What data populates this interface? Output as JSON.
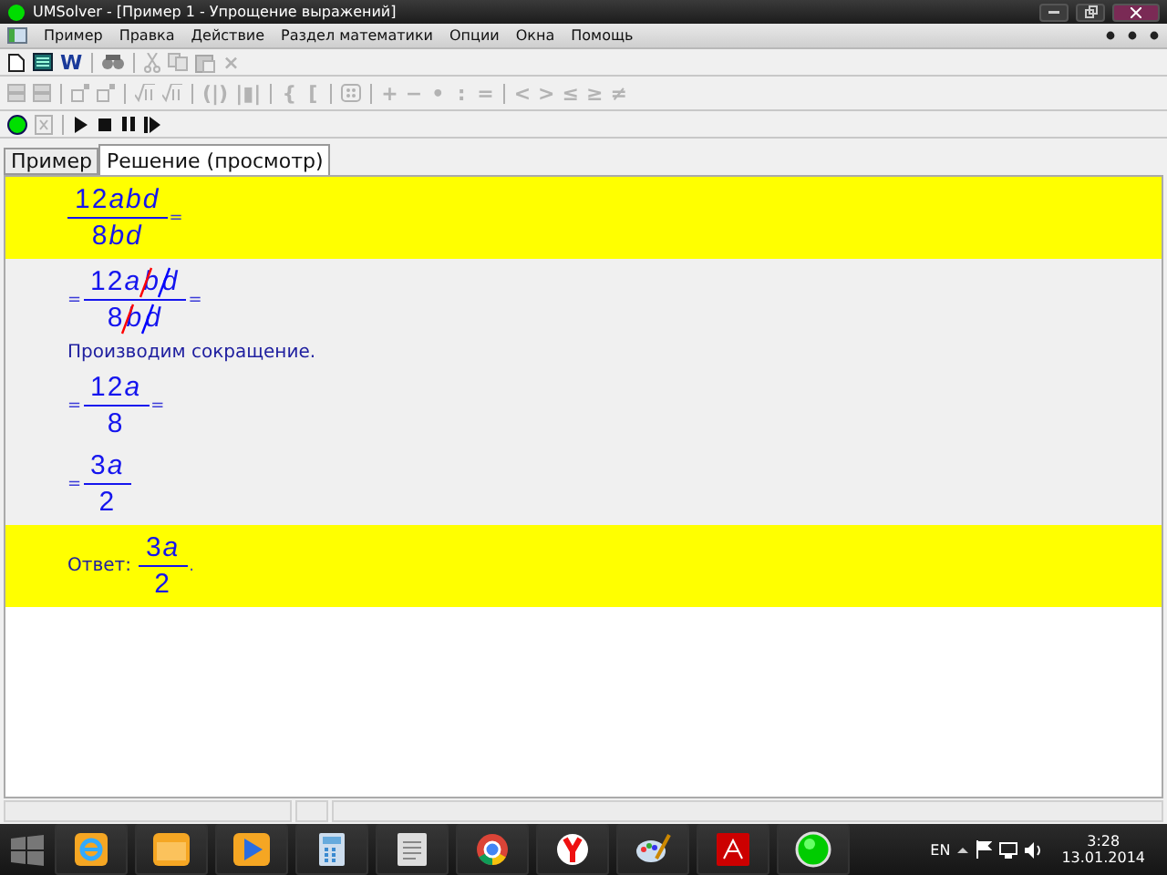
{
  "window": {
    "title": "UMSolver - [Пример 1 - Упрощение выражений]"
  },
  "menu": [
    "Пример",
    "Правка",
    "Действие",
    "Раздел математики",
    "Опции",
    "Окна",
    "Помощь"
  ],
  "toolbars": [
    [
      {
        "kind": "icon",
        "disabled": false
      },
      {
        "kind": "icon",
        "disabled": false
      },
      {
        "kind": "glyph",
        "text": "W",
        "disabled": false
      },
      {
        "kind": "sep"
      },
      {
        "kind": "icon",
        "disabled": false
      },
      {
        "kind": "sep"
      },
      {
        "kind": "icon",
        "disabled": true
      },
      {
        "kind": "icon",
        "disabled": true
      },
      {
        "kind": "icon",
        "disabled": true
      },
      {
        "kind": "glyph",
        "text": "×",
        "disabled": true
      }
    ],
    [
      {
        "kind": "icon",
        "disabled": true
      },
      {
        "kind": "icon",
        "disabled": true
      },
      {
        "kind": "sep"
      },
      {
        "kind": "icon",
        "disabled": true
      },
      {
        "kind": "icon",
        "disabled": true
      },
      {
        "kind": "sep"
      },
      {
        "kind": "icon",
        "disabled": true
      },
      {
        "kind": "icon",
        "disabled": true
      },
      {
        "kind": "sep"
      },
      {
        "kind": "glyph",
        "text": "(|)",
        "disabled": true
      },
      {
        "kind": "glyph",
        "text": "|▮|",
        "disabled": true
      },
      {
        "kind": "sep"
      },
      {
        "kind": "glyph",
        "text": "{",
        "disabled": true
      },
      {
        "kind": "glyph",
        "text": "[",
        "disabled": true
      },
      {
        "kind": "sep"
      },
      {
        "kind": "icon",
        "disabled": true
      },
      {
        "kind": "sep"
      },
      {
        "kind": "glyph",
        "text": "+",
        "disabled": true
      },
      {
        "kind": "glyph",
        "text": "−",
        "disabled": true
      },
      {
        "kind": "glyph",
        "text": "•",
        "disabled": true
      },
      {
        "kind": "glyph",
        "text": ":",
        "disabled": true
      },
      {
        "kind": "glyph",
        "text": "=",
        "disabled": true
      },
      {
        "kind": "sep"
      },
      {
        "kind": "glyph",
        "text": "<",
        "disabled": true
      },
      {
        "kind": "glyph",
        "text": ">",
        "disabled": true
      },
      {
        "kind": "glyph",
        "text": "≤",
        "disabled": true
      },
      {
        "kind": "glyph",
        "text": "≥",
        "disabled": true
      },
      {
        "kind": "glyph",
        "text": "≠",
        "disabled": true
      }
    ],
    [
      {
        "kind": "icon",
        "disabled": false
      },
      {
        "kind": "icon",
        "disabled": true
      },
      {
        "kind": "sep"
      },
      {
        "kind": "icon",
        "disabled": false
      },
      {
        "kind": "icon",
        "disabled": false
      },
      {
        "kind": "icon",
        "disabled": false
      },
      {
        "kind": "icon",
        "disabled": false
      }
    ]
  ],
  "tabs": [
    {
      "label": "Пример",
      "selected": false
    },
    {
      "label": "Решение (просмотр)",
      "selected": true
    }
  ],
  "solution": [
    {
      "highlight": true,
      "lines": [
        [
          {
            "kind": "frac",
            "num": [
              {
                "text": "12abd"
              }
            ],
            "den": [
              {
                "text": "8bd"
              }
            ]
          },
          {
            "kind": "op",
            "text": "="
          }
        ]
      ]
    },
    {
      "highlight": false,
      "lines": [
        [
          {
            "kind": "op",
            "text": "="
          },
          {
            "kind": "frac",
            "num": [
              {
                "text": "12a",
                "struck": false
              },
              {
                "text": "b",
                "struck": true,
                "color": "#ff0000"
              },
              {
                "text": "d",
                "struck": true,
                "color": "#0000ff"
              }
            ],
            "den": [
              {
                "text": "8",
                "struck": false
              },
              {
                "text": "b",
                "struck": true,
                "color": "#ff0000"
              },
              {
                "text": "d",
                "struck": true,
                "color": "#0000ff"
              }
            ]
          },
          {
            "kind": "op",
            "text": "="
          }
        ],
        [
          {
            "kind": "note",
            "text": "Производим сокращение."
          }
        ],
        [
          {
            "kind": "op",
            "text": "="
          },
          {
            "kind": "frac",
            "num": [
              {
                "text": "12a"
              }
            ],
            "den": [
              {
                "text": "8"
              }
            ]
          },
          {
            "kind": "op",
            "text": "="
          }
        ],
        [
          {
            "kind": "op",
            "text": "="
          },
          {
            "kind": "frac",
            "num": [
              {
                "text": "3a"
              }
            ],
            "den": [
              {
                "text": "2"
              }
            ]
          }
        ]
      ]
    },
    {
      "highlight": true,
      "lines": [
        [
          {
            "kind": "note",
            "text": "Ответ:"
          },
          {
            "kind": "frac",
            "num": [
              {
                "text": "3a"
              }
            ],
            "den": [
              {
                "text": "2"
              }
            ]
          },
          {
            "kind": "op",
            "text": "."
          }
        ]
      ]
    }
  ],
  "taskbar": {
    "language": "EN",
    "time": "3:28",
    "date": "13.01.2014"
  }
}
